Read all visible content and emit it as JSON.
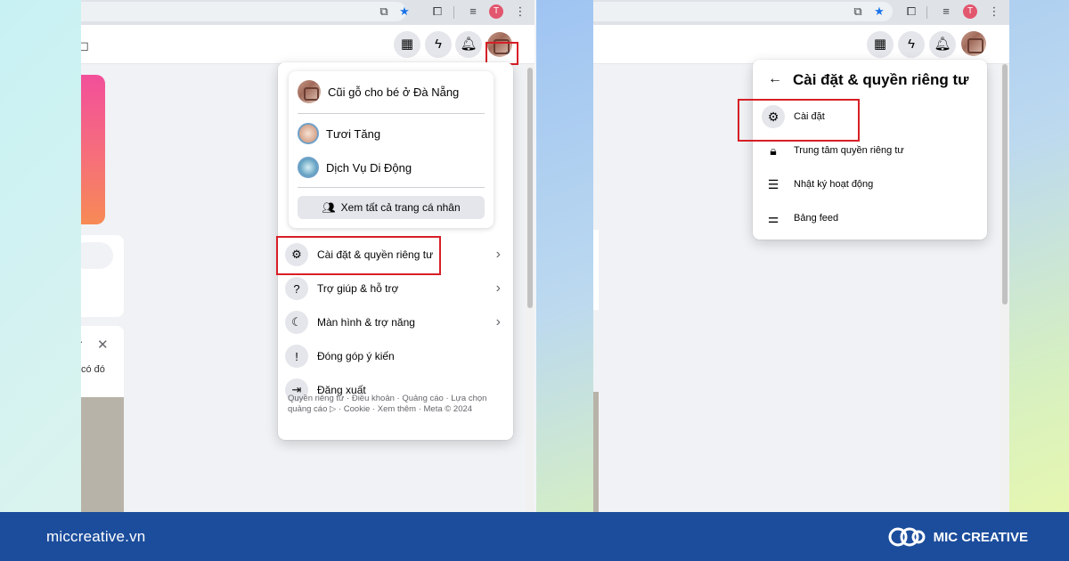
{
  "colors": {
    "highlight": "#d71f26",
    "footer": "#1c4d9c",
    "story": "#f24f9a",
    "link": "#1a73e8"
  },
  "browser": {
    "profile_initial": "T"
  },
  "left_panel": {
    "partial_text": "có đó",
    "menu": {
      "profiles": [
        {
          "name": "Cũi gỗ cho bé ở Đà Nẵng",
          "icon": "page-avatar-icon"
        },
        {
          "name": "Tươi Tăng",
          "icon": "switch-avatar-icon"
        },
        {
          "name": "Dịch Vụ Di Động",
          "icon": "switch-avatar-icon"
        }
      ],
      "see_all": "Xem tất cả trang cá nhân",
      "items": [
        {
          "label": "Cài đặt & quyền riêng tư",
          "icon": "gear-icon",
          "has_chevron": true
        },
        {
          "label": "Trợ giúp & hỗ trợ",
          "icon": "question-icon",
          "has_chevron": true
        },
        {
          "label": "Màn hình & trợ năng",
          "icon": "moon-icon",
          "has_chevron": true
        },
        {
          "label": "Đóng góp ý kiến",
          "icon": "feedback-icon",
          "has_chevron": false
        },
        {
          "label": "Đăng xuất",
          "icon": "logout-icon",
          "has_chevron": false
        }
      ],
      "footer_line1": "Quyền riêng tư · Điều khoản · Quảng cáo · Lựa chọn",
      "footer_line2": "quảng cáo ▷ · Cookie · Xem thêm · Meta © 2024"
    }
  },
  "right_panel": {
    "menu": {
      "title": "Cài đặt & quyền riêng tư",
      "items": [
        {
          "label": "Cài đặt",
          "icon": "gear-icon"
        },
        {
          "label": "Trung tâm quyền riêng tư",
          "icon": "lock-icon"
        },
        {
          "label": "Nhật ký hoạt động",
          "icon": "list-icon"
        },
        {
          "label": "Bảng feed",
          "icon": "sliders-icon"
        }
      ]
    }
  },
  "footer": {
    "site": "miccreative.vn",
    "brand": "MIC CREATIVE"
  }
}
